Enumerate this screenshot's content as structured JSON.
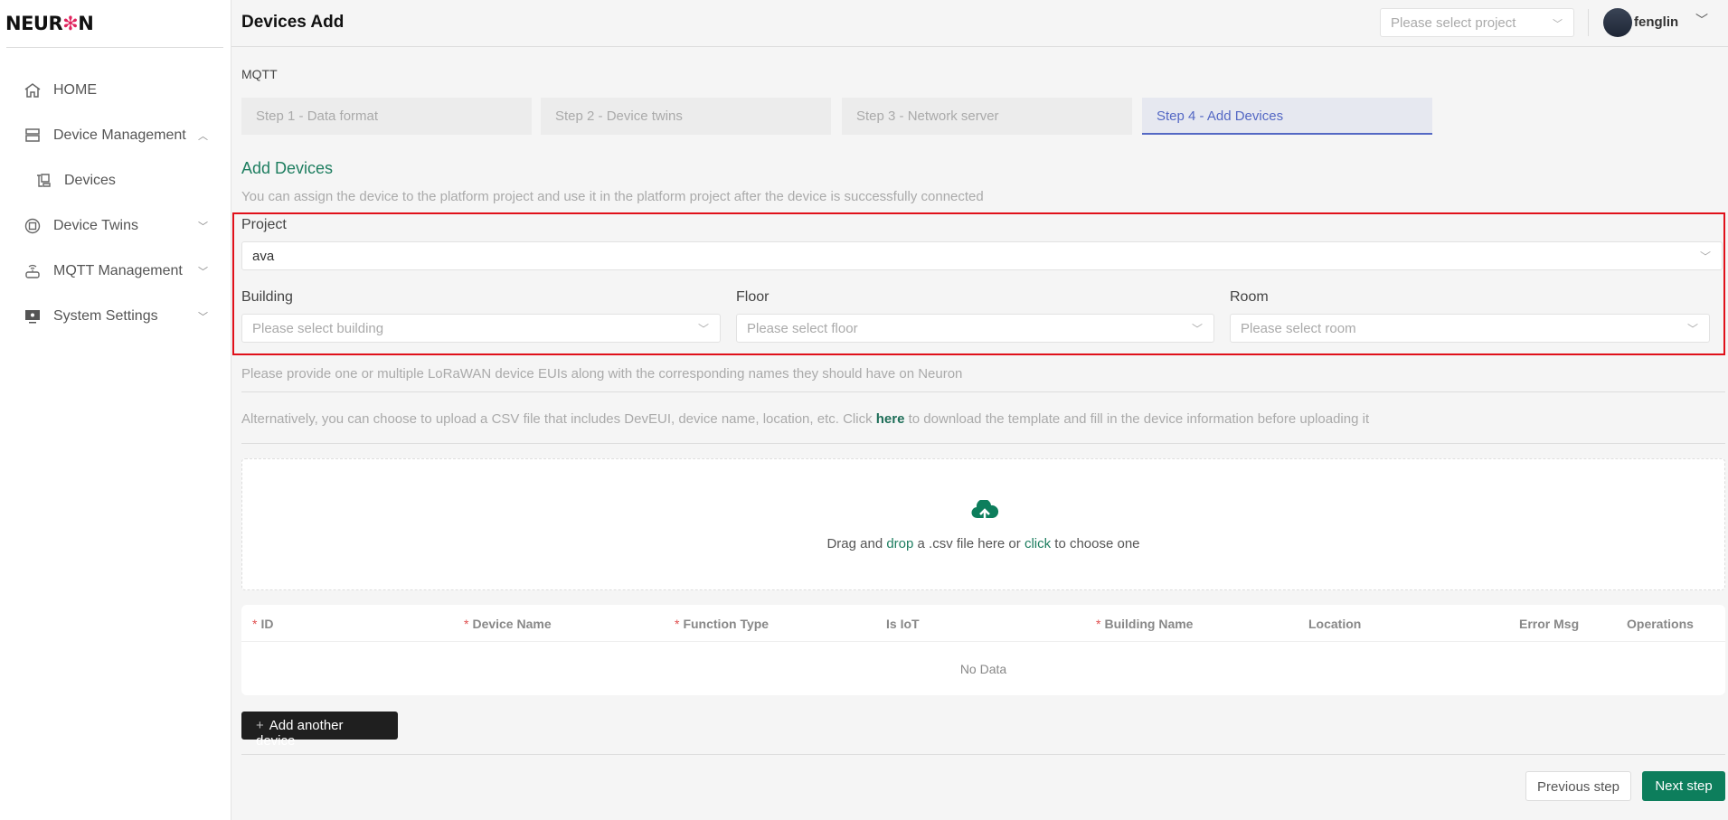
{
  "sidebar": {
    "logo": "NEURON",
    "items": [
      {
        "label": "HOME",
        "icon": "home-icon"
      },
      {
        "label": "Device Management",
        "icon": "server-icon",
        "expanded": true
      },
      {
        "label": "Devices",
        "icon": "devices-icon"
      },
      {
        "label": "Device Twins",
        "icon": "twins-icon"
      },
      {
        "label": "MQTT Management",
        "icon": "router-icon"
      },
      {
        "label": "System Settings",
        "icon": "monitor-icon"
      }
    ]
  },
  "header": {
    "title": "Devices Add",
    "project_placeholder": "Please select project",
    "username": "fenglin"
  },
  "main": {
    "protocol": "MQTT",
    "steps": [
      "Step 1 - Data format",
      "Step 2 - Device twins",
      "Step 3 - Network server",
      "Step 4 - Add Devices"
    ],
    "active_step": 4,
    "section_title": "Add Devices",
    "section_desc": "You can assign the device to the platform project and use it in the platform project after the device is successfully connected",
    "form": {
      "project_label": "Project",
      "project_value": "ava",
      "building_label": "Building",
      "building_placeholder": "Please select building",
      "floor_label": "Floor",
      "floor_placeholder": "Please select floor",
      "room_label": "Room",
      "room_placeholder": "Please select room"
    },
    "lorawan_text": "Please provide one or multiple LoRaWAN device EUIs along with the corresponding names they should have on Neuron",
    "csv_text_before": "Alternatively, you can choose to upload a CSV file that includes DevEUI, device name, location, etc. Click",
    "csv_link": "here",
    "csv_text_after": "to download the template and fill in the device information before uploading it",
    "dropzone": {
      "t1": "Drag and ",
      "t2": "drop",
      "t3": " a .csv file here or ",
      "t4": "click",
      "t5": " to choose one"
    },
    "table": {
      "columns": [
        {
          "label": "ID",
          "required": "*"
        },
        {
          "label": "Device Name",
          "required": "*"
        },
        {
          "label": "Function Type",
          "required": "*"
        },
        {
          "label": "Is IoT",
          "required": ""
        },
        {
          "label": "Building Name",
          "required": "*"
        },
        {
          "label": "Location",
          "required": ""
        },
        {
          "label": "Error Msg",
          "required": ""
        },
        {
          "label": "Operations",
          "required": ""
        }
      ],
      "empty_text": "No Data"
    },
    "add_device_label": "Add another device",
    "prev_label": "Previous step",
    "next_label": "Next step"
  },
  "colors": {
    "accent": "#0d7e5c",
    "active_step": "#5468c4",
    "highlight_box": "#e0101a"
  }
}
